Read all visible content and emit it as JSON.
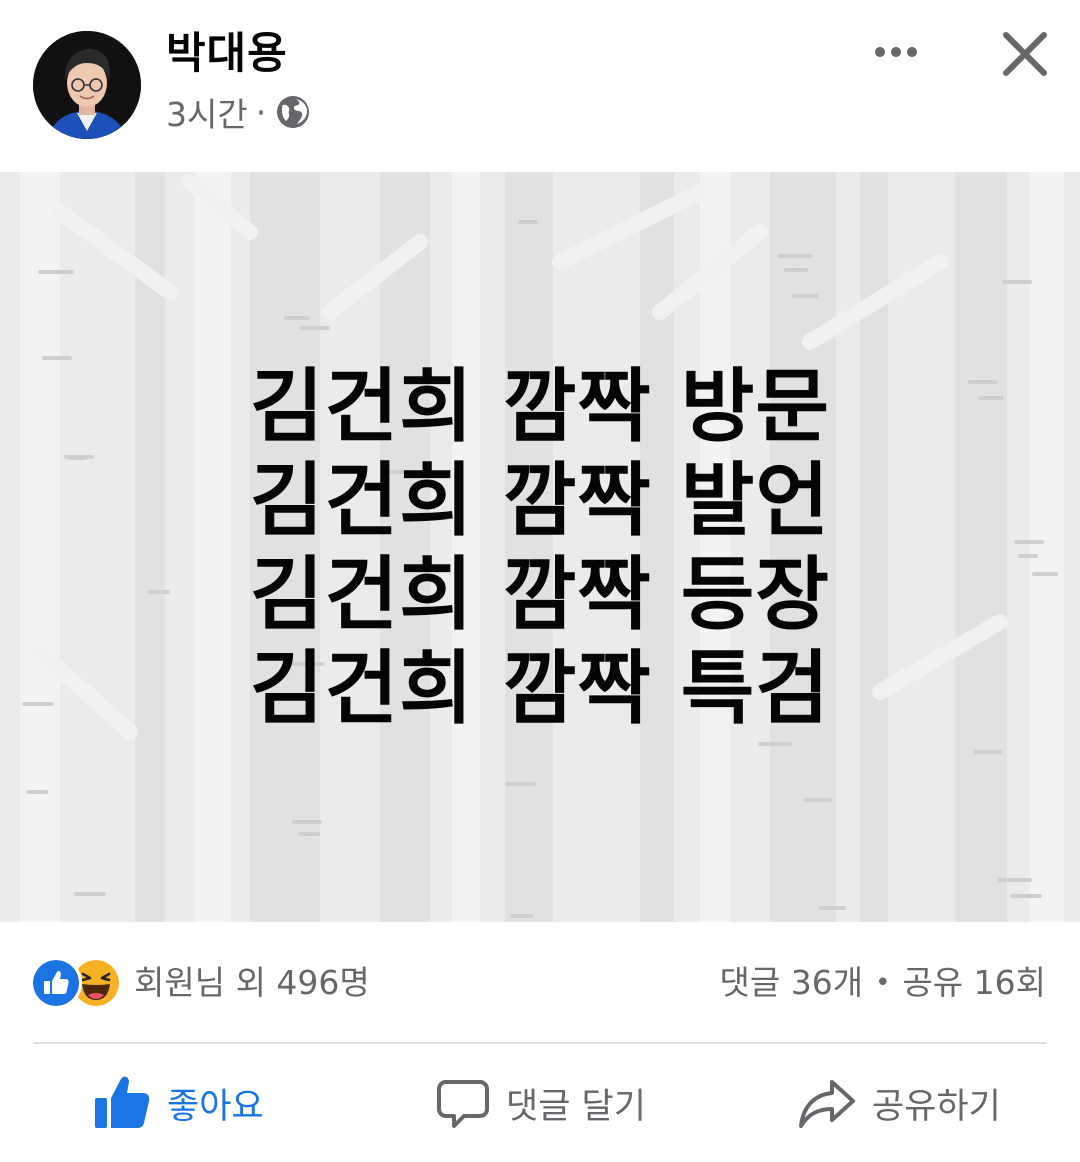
{
  "post": {
    "author": "박대용",
    "time": "3시간",
    "dot": "·",
    "privacy_icon": "globe-icon",
    "header_icons": [
      "more-icon",
      "close-icon"
    ],
    "lines": [
      "김건희 깜짝 방문",
      "김건희 깜짝 발언",
      "김건희 깜짝 등장",
      "김건희 깜짝 특검"
    ]
  },
  "reactions": {
    "icons": [
      "like-reaction-icon",
      "haha-reaction-icon"
    ],
    "summary": "회원님 외 496명",
    "comments": "댓글 36개",
    "separator": "•",
    "shares": "공유 16회"
  },
  "actions": {
    "like": "좋아요",
    "comment": "댓글 달기",
    "share": "공유하기"
  },
  "colors": {
    "accent": "#1b74e4",
    "secondary_text": "#65676b",
    "primary_text": "#050505",
    "image_background": "#ebebeb",
    "divider": "#dadde1",
    "haha_yellow": "#f7b125"
  }
}
